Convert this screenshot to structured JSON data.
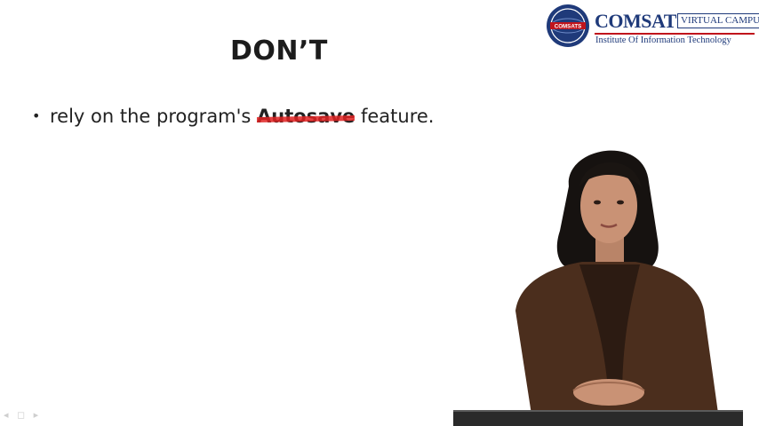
{
  "logo": {
    "name": "COMSATS",
    "badge": "VIRTUAL CAMPUS",
    "subtitle": "Institute Of Information Technology",
    "seal_text": "COMSATS",
    "colors": {
      "navy": "#1f3a7a",
      "red": "#c0141c"
    }
  },
  "slide": {
    "title": "DON’T",
    "bullets": [
      {
        "prefix": "rely on the program's ",
        "struck": "Autosave",
        "suffix": " feature."
      }
    ],
    "strike_color": "#e02222"
  },
  "nav": {
    "glyphs": "◂ ◻ ▸"
  }
}
